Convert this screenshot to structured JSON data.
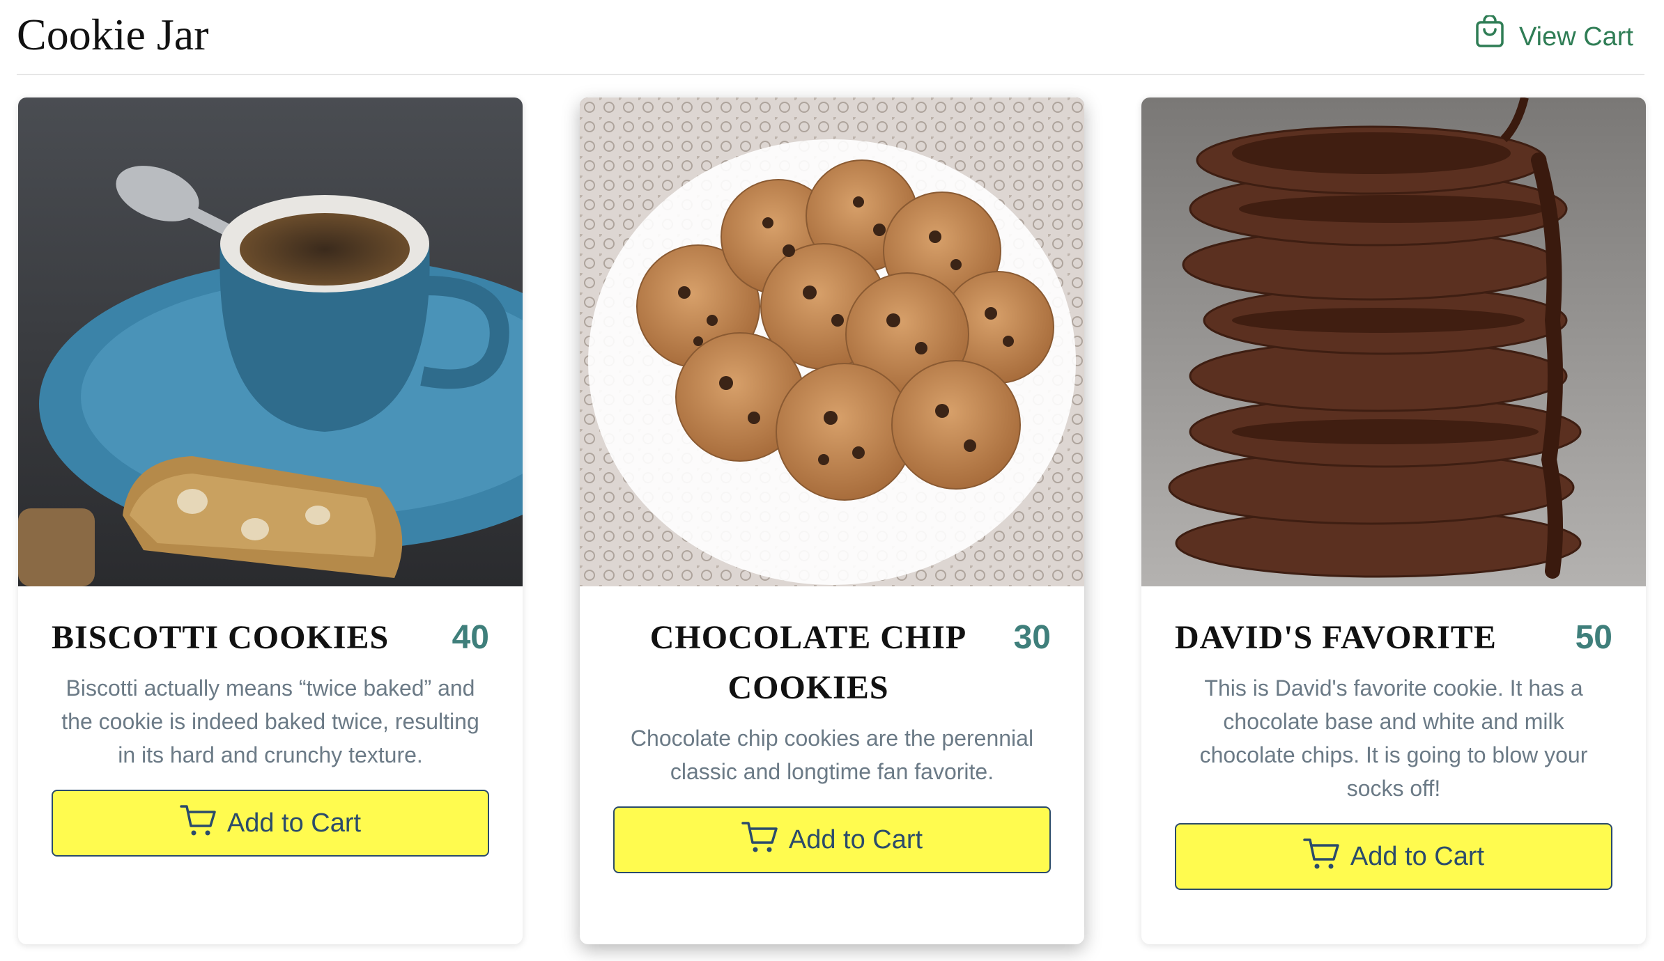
{
  "header": {
    "brand": "Cookie Jar",
    "view_cart_label": "View Cart",
    "view_cart_icon": "shopping-bag-icon",
    "accent_color": "#2f7d55"
  },
  "products": [
    {
      "name": "BISCOTTI COOKIES",
      "price": "40",
      "description": "Biscotti actually means “twice baked” and the cookie is indeed baked twice, resulting in its hard and crunchy texture.",
      "button_label": "Add to Cart",
      "button_icon": "cart-icon"
    },
    {
      "name": "CHOCOLATE CHIP COOKIES",
      "price": "30",
      "description": "Chocolate chip cookies are the perennial classic and longtime fan favorite.",
      "button_label": "Add to Cart",
      "button_icon": "cart-icon"
    },
    {
      "name": "DAVID'S FAVORITE",
      "price": "50",
      "description": "This is David's favorite cookie. It has a chocolate base and white and milk chocolate chips. It is going to blow your socks off!",
      "button_label": "Add to Cart",
      "button_icon": "cart-icon"
    }
  ],
  "colors": {
    "button_background": "#fffb4f",
    "button_text": "#2b4b6b",
    "price": "#3f7f7b",
    "description": "#6b7a86"
  }
}
